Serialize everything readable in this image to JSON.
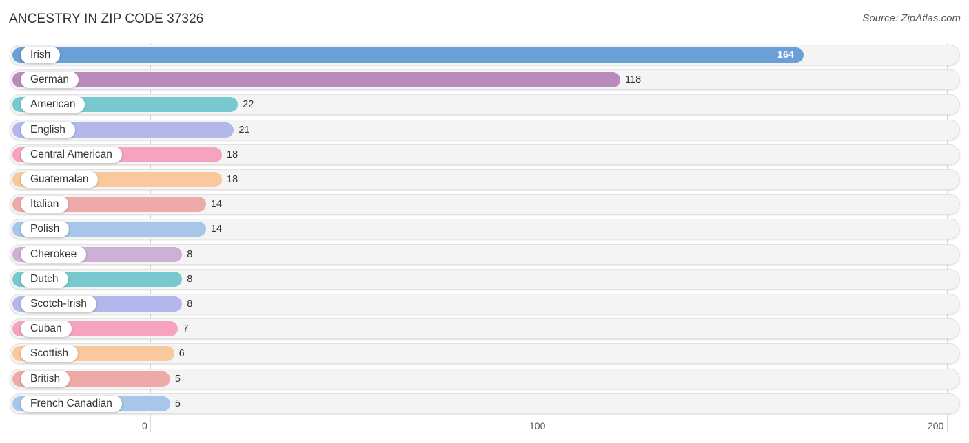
{
  "header": {
    "title": "ANCESTRY IN ZIP CODE 37326",
    "source": "Source: ZipAtlas.com"
  },
  "chart_data": {
    "type": "bar",
    "orientation": "horizontal",
    "title": "ANCESTRY IN ZIP CODE 37326",
    "xlabel": "",
    "ylabel": "",
    "xlim": [
      0,
      200
    ],
    "xticks": [
      0,
      100,
      200
    ],
    "grid": true,
    "categories": [
      "Irish",
      "German",
      "American",
      "English",
      "Central American",
      "Guatemalan",
      "Italian",
      "Polish",
      "Cherokee",
      "Dutch",
      "Scotch-Irish",
      "Cuban",
      "Scottish",
      "British",
      "French Canadian"
    ],
    "values": [
      164,
      118,
      22,
      21,
      18,
      18,
      14,
      14,
      8,
      8,
      8,
      7,
      6,
      5,
      5
    ],
    "colors": [
      "#6a9fd8",
      "#b98bbd",
      "#78c9cf",
      "#b3b8ea",
      "#f5a3bf",
      "#f9c89c",
      "#eeaaa8",
      "#a7c6ea",
      "#cdb1d4",
      "#78c9cf",
      "#b3b8ea",
      "#f5a3bf",
      "#f9c89c",
      "#eeaaa8",
      "#a7c6ea"
    ]
  }
}
